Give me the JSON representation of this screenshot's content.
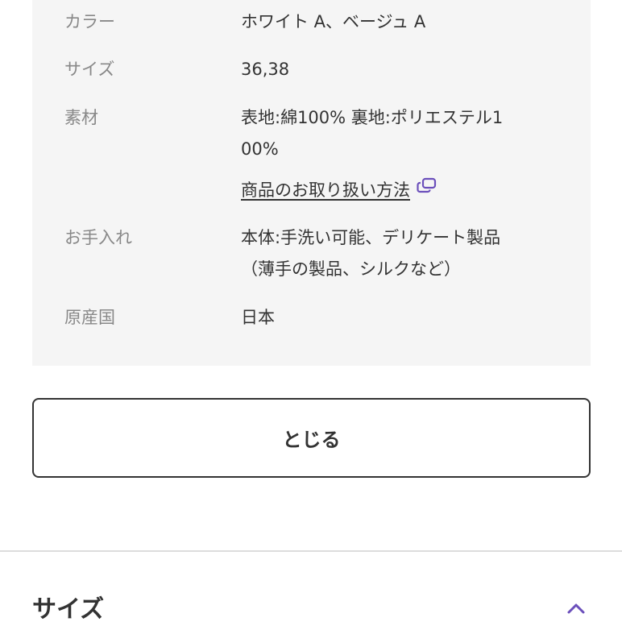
{
  "spec": {
    "rows": [
      {
        "label": "カラー",
        "value": "ホワイト A、ベージュ A"
      },
      {
        "label": "サイズ",
        "value": "36,38"
      },
      {
        "label": "素材",
        "value_line1": "表地:綿100% 裏地:ポリエステル1",
        "value_line2": "00%",
        "link": "商品のお取り扱い方法"
      },
      {
        "label": "お手入れ",
        "value_line1": "本体:手洗い可能、デリケート製品",
        "value_line2": "（薄手の製品、シルクなど）"
      },
      {
        "label": "原産国",
        "value": "日本"
      }
    ]
  },
  "close_button": {
    "label": "とじる"
  },
  "size_section": {
    "title": "サイズ"
  },
  "colors": {
    "accent": "#6b4fbb",
    "box_bg": "#f5f5f5",
    "label": "#888888",
    "text": "#333333"
  },
  "icons": {
    "external_link": "external-link-icon",
    "collapse": "chevron-up-icon"
  }
}
